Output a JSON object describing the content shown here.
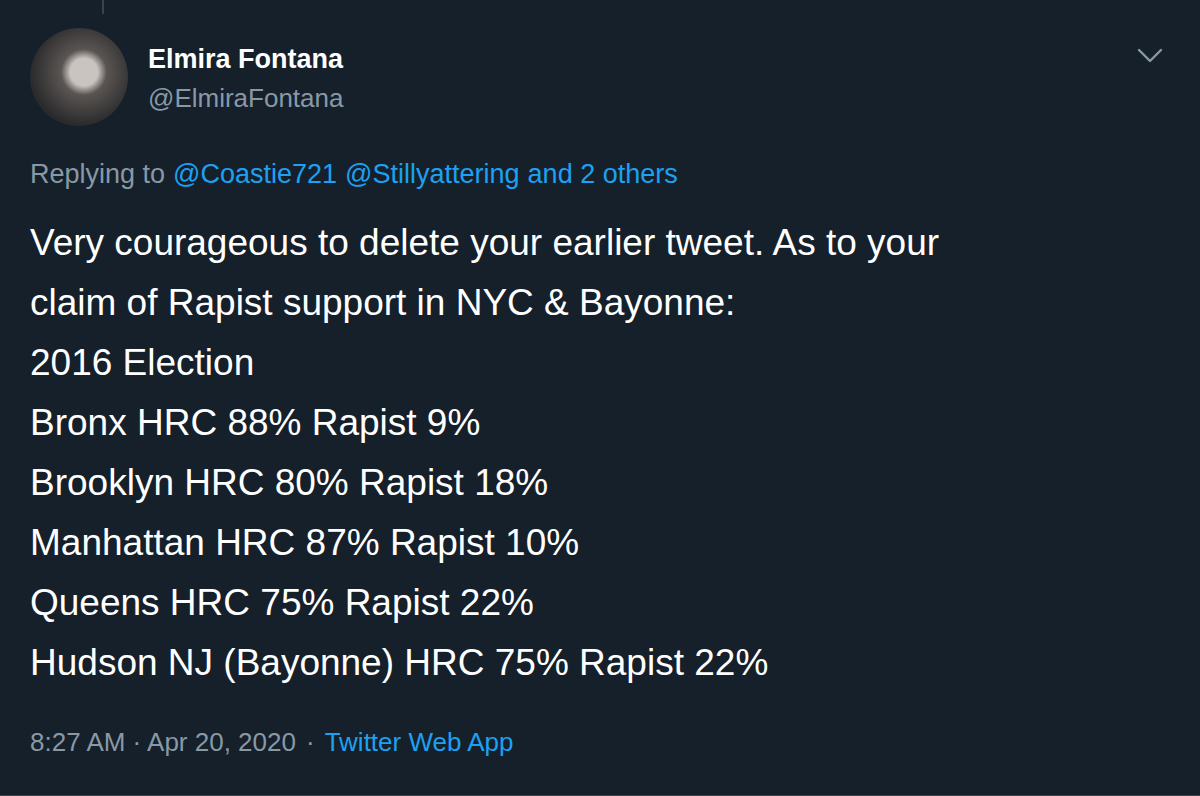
{
  "tweet": {
    "author": {
      "name": "Elmira Fontana",
      "handle": "@ElmiraFontana"
    },
    "replying_to": {
      "prefix": "Replying to",
      "mentions": [
        "@Coastie721",
        "@Stillyattering"
      ],
      "suffix": "and 2 others"
    },
    "body_lines": [
      "Very courageous to delete your earlier tweet. As to your",
      "claim of Rapist support in NYC & Bayonne:",
      "2016 Election",
      "Bronx HRC 88% Rapist 9%",
      "Brooklyn HRC 80% Rapist 18%",
      "Manhattan HRC 87% Rapist 10%",
      "Queens HRC 75% Rapist 22%",
      "Hudson NJ (Bayonne) HRC 75% Rapist 22%"
    ],
    "timestamp": "8:27 AM · Apr 20, 2020",
    "separator": "·",
    "source": "Twitter Web App"
  }
}
